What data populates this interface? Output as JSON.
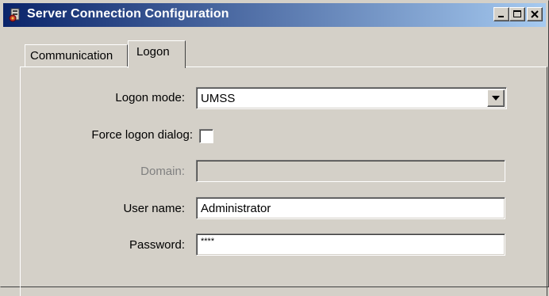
{
  "window": {
    "title": "Server Connection Configuration",
    "icon": "server-config-icon",
    "controls": [
      "minimize-icon",
      "maximize-icon",
      "close-icon"
    ]
  },
  "tabs": [
    {
      "label": "Communication",
      "active": false
    },
    {
      "label": "Logon",
      "active": true
    }
  ],
  "form": {
    "logon_mode": {
      "label": "Logon mode:",
      "value": "UMSS"
    },
    "force_logon_dialog": {
      "label": "Force logon dialog:",
      "checked": false
    },
    "domain": {
      "label": "Domain:",
      "value": "",
      "disabled": true
    },
    "user_name": {
      "label": "User name:",
      "value": "Administrator"
    },
    "password": {
      "label": "Password:",
      "value": "****"
    }
  },
  "colors": {
    "title_gradient_start": "#0a246a",
    "title_gradient_end": "#a6caf0",
    "face": "#d4d0c8"
  }
}
